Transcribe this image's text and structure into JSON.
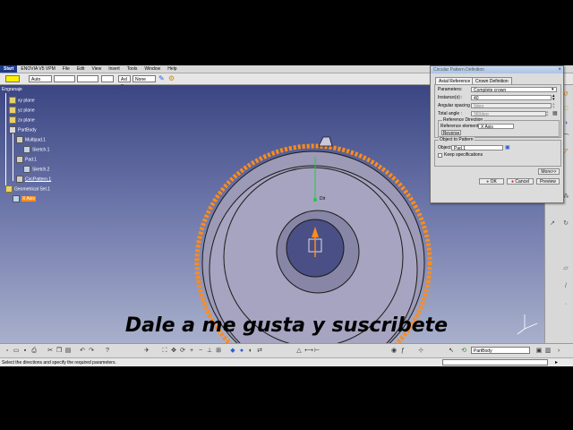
{
  "menu": {
    "items": [
      "Start",
      "ENOVIA V5 VPM",
      "File",
      "Edit",
      "View",
      "Insert",
      "Tools",
      "Window",
      "Help"
    ]
  },
  "prop_toolbar": {
    "color_hex": "#ffef00",
    "combo_transparency": "Auto",
    "combo_line_type": "",
    "combo_line_weight": "",
    "combo_layer_label": "Axl 2",
    "combo_layer_value": "None"
  },
  "tree": {
    "root": "Engranaje",
    "xy_plane": "xy plane",
    "yz_plane": "yz plane",
    "zx_plane": "zx plane",
    "part_body": "PartBody",
    "multipad": "Multipad.1",
    "sketch1": "Sketch.1",
    "pad1": "Pad.1",
    "sketch2": "Sketch.2",
    "circ_pattern": "CircPattern.1",
    "geo_set": "Geometrical Set.1",
    "x_axis": "X Axis"
  },
  "model": {
    "dir_label": "Dir"
  },
  "dialog": {
    "title": "Circular Pattern Definition",
    "close": "×",
    "tab_axial": "Axial Reference",
    "tab_crown": "Crown Definition",
    "param_label": "Parameters:",
    "param_value": "Complete crown",
    "instances_label": "Instance(s) :",
    "instances_value": "40",
    "angular_label": "Angular spacing :",
    "angular_value": "9deg",
    "total_label": "Total angle :",
    "total_value": "360deg",
    "ref_dir_title": "Reference Direction",
    "ref_element_label": "Reference element:",
    "ref_element_value": "X Axis",
    "reverse": "Reverse",
    "object_group_title": "Object to Pattern",
    "object_label": "Object:",
    "object_value": "Pad.1",
    "keep_spec": "Keep specifications",
    "more": "More>>",
    "ok": "OK",
    "cancel": "Cancel",
    "preview": "Preview"
  },
  "bottom": {
    "part_body_combo": "PartBody"
  },
  "status": {
    "message": "Select the directions and specify the required parameters."
  },
  "overlay": {
    "caption": "Dale a me gusta y suscribete"
  },
  "colors": {
    "viewport_top": "#3b4582",
    "viewport_bottom": "#a9b0cc",
    "gear_fill": "#9c9ab6",
    "preview_orange": "#ff8c1a",
    "selection_orange": "#ff8c1a"
  }
}
